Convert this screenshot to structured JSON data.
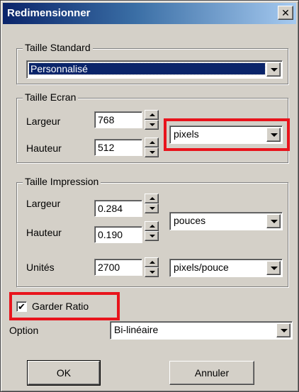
{
  "window": {
    "title": "Redimensionner",
    "close_icon": "close-icon"
  },
  "taille_standard": {
    "legend": "Taille Standard",
    "selected": "Personnalisé"
  },
  "taille_ecran": {
    "legend": "Taille Ecran",
    "largeur_label": "Largeur",
    "largeur_value": "768",
    "hauteur_label": "Hauteur",
    "hauteur_value": "512",
    "unit_selected": "pixels"
  },
  "taille_impression": {
    "legend": "Taille Impression",
    "largeur_label": "Largeur",
    "largeur_value": "0.284",
    "hauteur_label": "Hauteur",
    "hauteur_value": "0.190",
    "unit_selected": "pouces",
    "unites_label": "Unités",
    "unites_value": "2700",
    "resolution_selected": "pixels/pouce"
  },
  "garder_ratio": {
    "label": "Garder Ratio",
    "checked": true,
    "check_mark": "✔"
  },
  "option": {
    "label": "Option",
    "selected": "Bi-linéaire"
  },
  "buttons": {
    "ok": "OK",
    "cancel": "Annuler"
  },
  "colors": {
    "highlight": "#e8141c",
    "title_bar": "#0a246a",
    "dialog_bg": "#d4d0c8"
  }
}
